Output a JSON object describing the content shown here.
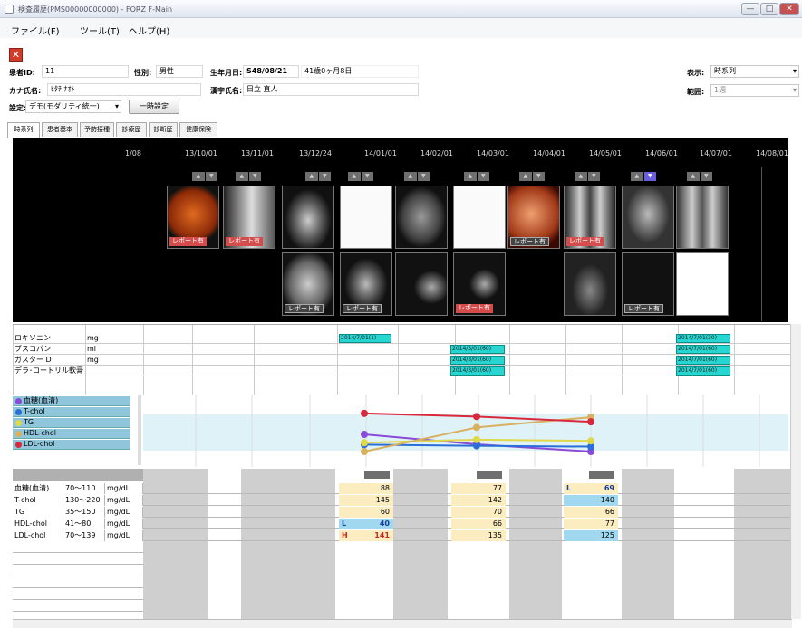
{
  "window": {
    "title": "検査履歴(PMS00000000000) - FORZ F-Main",
    "btn_min": "—",
    "btn_max": "□",
    "btn_close": "✕",
    "close_color": "#c75050"
  },
  "menu": {
    "items": [
      "ファイル(F)",
      "ツール(T)",
      "ヘルプ(H)"
    ]
  },
  "patient": {
    "id_label": "患者ID:",
    "id_value": "11",
    "sex_label": "性別:",
    "sex_value": "男性",
    "dob_label": "生年月日:",
    "dob_value": "S48/08/21",
    "age_value": "41歳0ヶ月8日",
    "kana_label": "カナ氏名:",
    "kana_value": "ﾋﾀﾁ ﾅｵﾄ",
    "kanji_label": "漢字氏名:",
    "kanji_value": "日立 直人",
    "setting_label": "設定:",
    "setting_value": "デモ(モダリティ統一)",
    "temp_button": "一時設定",
    "display_label": "表示:",
    "display_value": "時系列",
    "range_label": "範囲:",
    "range_value": "1週"
  },
  "tabs": [
    "時系列",
    "患者基本",
    "予防接種",
    "診療歴",
    "診断歴",
    "健康保険"
  ],
  "timeline": {
    "dates": [
      "1/08",
      "13/10/01",
      "13/11/01",
      "13/12/24",
      "14/01/01",
      "14/02/01",
      "14/03/01",
      "14/04/01",
      "14/05/01",
      "14/06/01",
      "14/07/01",
      "14/08/01"
    ],
    "report_badge": "レポート有",
    "arrow_up": "▲",
    "arrow_down": "▼"
  },
  "medications": [
    {
      "name": "ロキソニン",
      "unit": "mg",
      "entries": [
        "2014/7/01(1)",
        "2014/7/01(30)"
      ]
    },
    {
      "name": "ブスコパン",
      "unit": "ml",
      "entries": [
        "2014/3/01(60)",
        "2014/7/01(60)"
      ]
    },
    {
      "name": "ガスター D",
      "unit": "mg",
      "entries": [
        "2014/3/01(60)",
        "2014/7/01(60)"
      ]
    },
    {
      "name": "デラ･コートリル軟膏",
      "unit": "",
      "entries": [
        "2014/3/01(60)",
        "2014/7/01(60)"
      ]
    }
  ],
  "legend": [
    {
      "name": "血糖(血清)",
      "color": "#8a4ad8"
    },
    {
      "name": "T-chol",
      "color": "#2a6fd8"
    },
    {
      "name": "TG",
      "color": "#e0d84a"
    },
    {
      "name": "HDL-chol",
      "color": "#d8b060"
    },
    {
      "name": "LDL-chol",
      "color": "#d8283c"
    }
  ],
  "chart_data": {
    "type": "line",
    "categories": [
      "14/01/01",
      "14/03/01",
      "14/05/01"
    ],
    "series": [
      {
        "name": "血糖(血清)",
        "values": [
          88,
          77,
          69
        ]
      },
      {
        "name": "T-chol",
        "values": [
          145,
          142,
          140
        ]
      },
      {
        "name": "TG",
        "values": [
          60,
          70,
          66
        ]
      },
      {
        "name": "HDL-chol",
        "values": [
          40,
          66,
          77
        ]
      },
      {
        "name": "LDL-chol",
        "values": [
          141,
          135,
          125
        ]
      }
    ]
  },
  "labs": {
    "rows": [
      {
        "name": "血糖(血清)",
        "range": "70〜110",
        "unit": "mg/dL",
        "v1": "88",
        "v2": "77",
        "v3": "69",
        "f3": "L"
      },
      {
        "name": "T-chol",
        "range": "130〜220",
        "unit": "mg/dL",
        "v1": "145",
        "v2": "142",
        "v3": "140",
        "f3": ""
      },
      {
        "name": "TG",
        "range": "35〜150",
        "unit": "mg/dL",
        "v1": "60",
        "v2": "70",
        "v3": "66",
        "f3": ""
      },
      {
        "name": "HDL-chol",
        "range": "41〜80",
        "unit": "mg/dL",
        "v1": "40",
        "v2": "66",
        "v3": "77",
        "f1": "L"
      },
      {
        "name": "LDL-chol",
        "range": "70〜139",
        "unit": "mg/dL",
        "v1": "141",
        "v2": "135",
        "v3": "125",
        "f1": "H"
      }
    ]
  }
}
